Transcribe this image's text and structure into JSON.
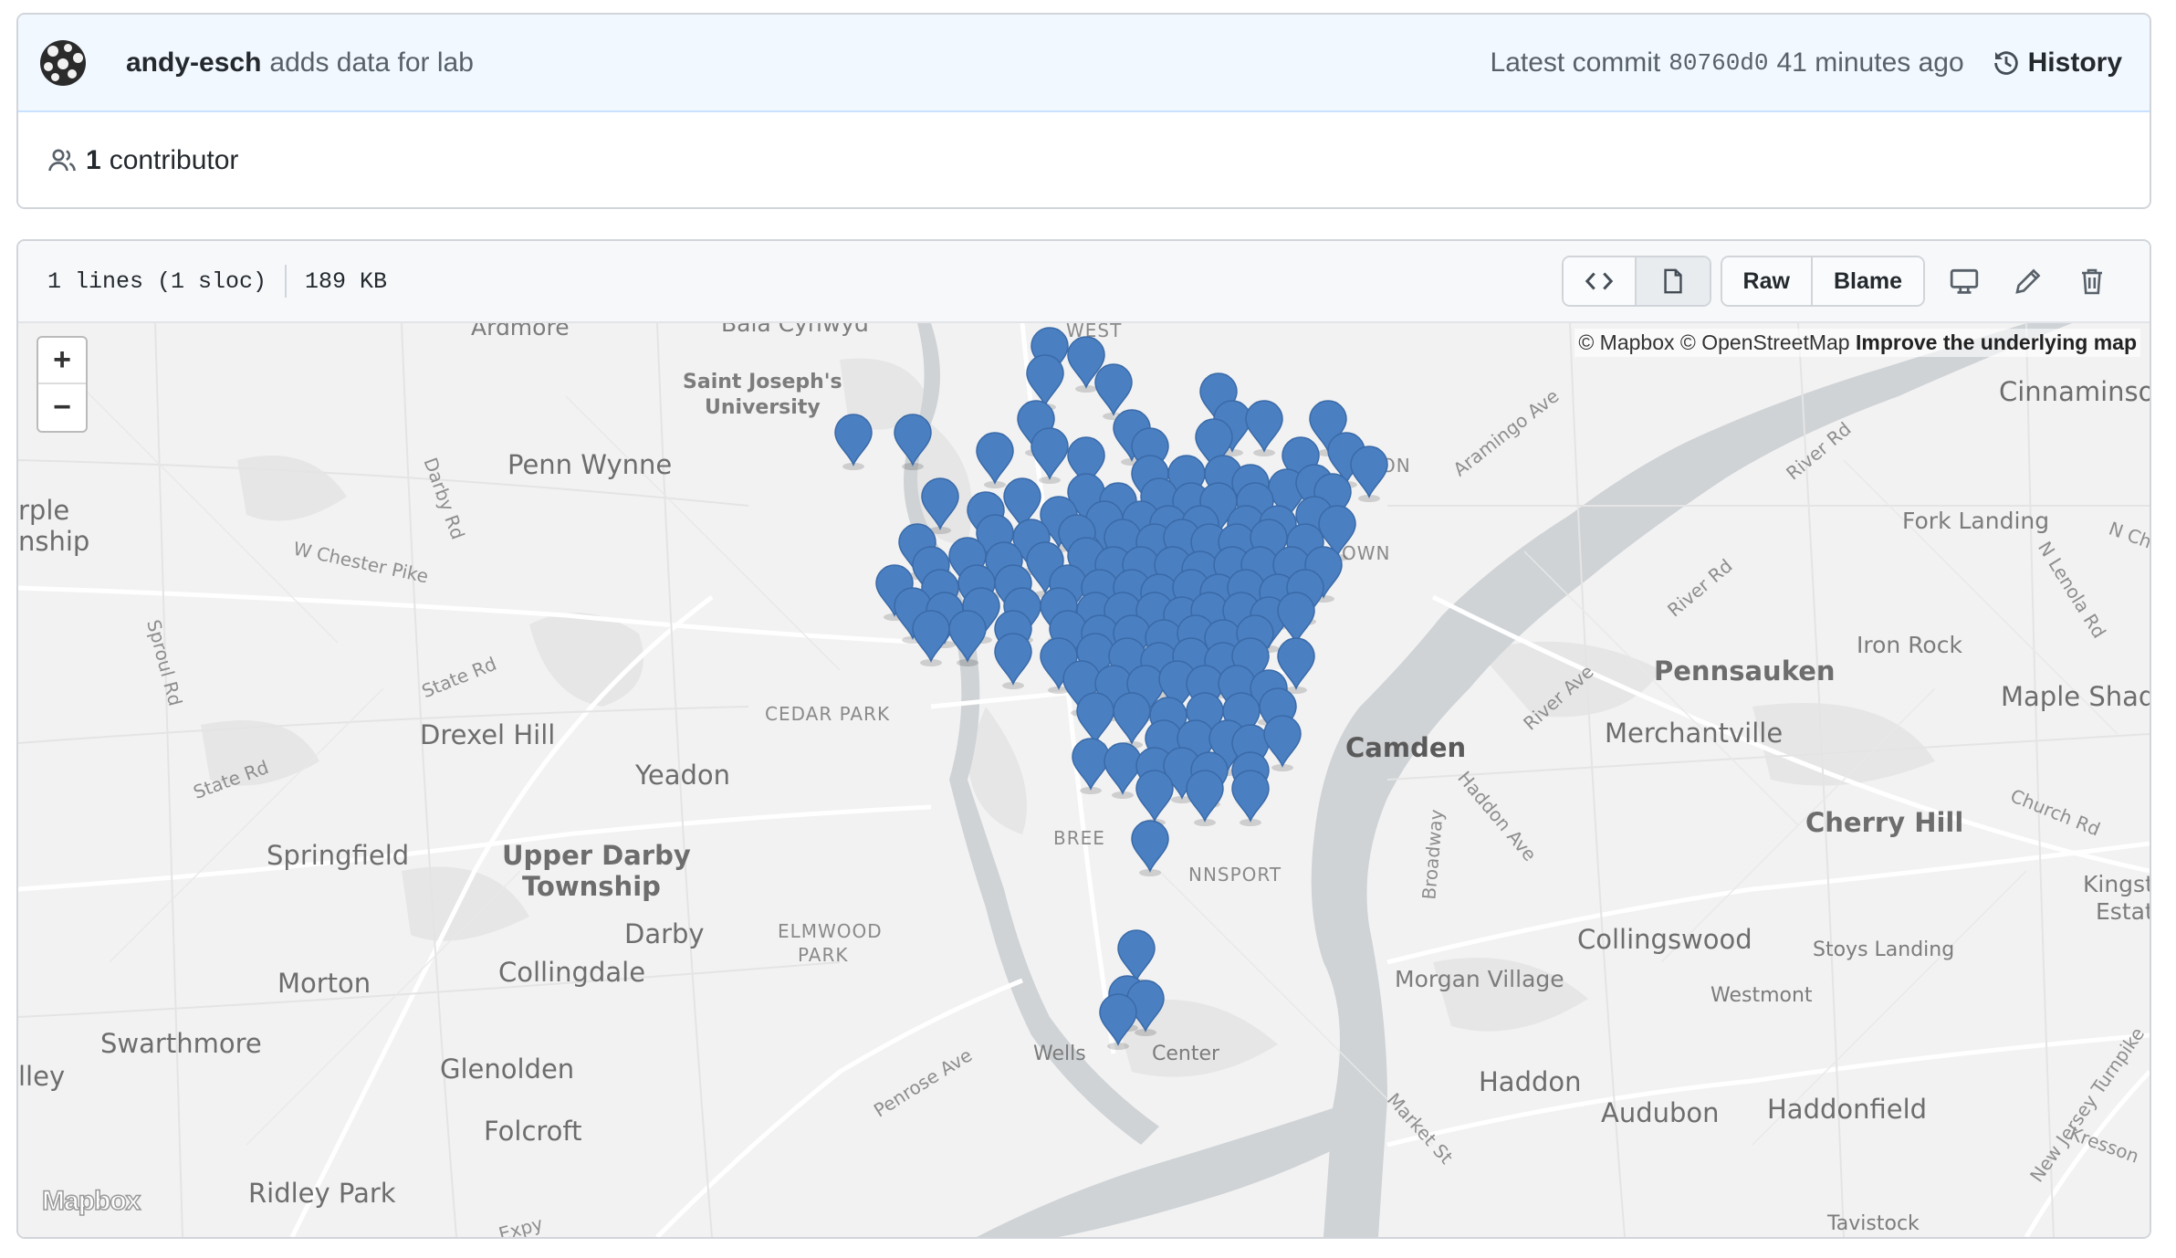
{
  "commit": {
    "author": "andy-esch",
    "message": "adds data for lab",
    "latest_label": "Latest commit",
    "sha": "80760d0",
    "time": "41 minutes ago",
    "history_label": "History",
    "contributor_count": "1",
    "contributor_label": "contributor"
  },
  "file": {
    "lines": "1 lines (1 sloc)",
    "size": "189 KB",
    "raw_label": "Raw",
    "blame_label": "Blame"
  },
  "map": {
    "zoom_in": "+",
    "zoom_out": "−",
    "attribution_mapbox": "© Mapbox",
    "attribution_osm": "© OpenStreetMap",
    "attribution_improve": "Improve the underlying map",
    "logo": "Mapbox",
    "marker_color": "#4a7fc1",
    "places": {
      "ardmore": "Ardmore",
      "bala": "Bala Cynwyd",
      "west": "WEST",
      "sju": "Saint Joseph's",
      "sju2": "University",
      "penn_wynne": "Penn Wynne",
      "darby_rd": "Darby Rd",
      "rple": "rple",
      "nship": "nship",
      "w_chester": "W Chester Pike",
      "sproul": "Sproul Rd",
      "state_rd1": "State Rd",
      "drexel_hill": "Drexel Hill",
      "state_rd2": "State Rd",
      "springfield": "Springfield",
      "yeadon": "Yeadon",
      "upper_darby": "Upper Darby",
      "township": "Township",
      "darby": "Darby",
      "morton": "Morton",
      "collingdale": "Collingdale",
      "swarthmore": "Swarthmore",
      "glenolden": "Glenolden",
      "lley": "lley",
      "folcroft": "Folcroft",
      "ridley_park": "Ridley Park",
      "cedar_park": "CEDAR PARK",
      "elmwood": "ELMWOOD",
      "elmwood2": "PARK",
      "penrose": "Penrose Ave",
      "wells": "Wells",
      "center": "Center",
      "bree": "BREE",
      "nnsport": "NNSPORT",
      "st": "St",
      "ngton": "NGTON",
      "own": "OWN",
      "aramingo": "Aramingo Ave",
      "river_rd1": "River Rd",
      "river_rd2": "River Rd",
      "river_ave": "River Ave",
      "cinnaminson": "Cinnaminson",
      "fork_landing": "Fork Landing",
      "n_ch": "N Ch",
      "n_lenola": "N Lenola Rd",
      "iron_rock": "Iron Rock",
      "pennsauken": "Pennsauken",
      "maple_shade": "Maple Shad",
      "merchantville": "Merchantville",
      "camden": "Camden",
      "church_rd": "Church Rd",
      "cherry_hill": "Cherry Hill",
      "kingston": "Kingston",
      "estates": "Estates",
      "haddon_ave": "Haddon Ave",
      "broadway": "Broadway",
      "collingswood": "Collingswood",
      "stoys": "Stoys Landing",
      "morgan": "Morgan Village",
      "westmont": "Westmont",
      "haddon": "Haddon",
      "audubon": "Audubon",
      "haddonfield": "Haddonfield",
      "market_st": "Market St",
      "nj_turnpike": "New Jersey Turnpike",
      "kresson": "Kresson",
      "tavistock": "Tavistock",
      "expy": "Expy"
    }
  }
}
